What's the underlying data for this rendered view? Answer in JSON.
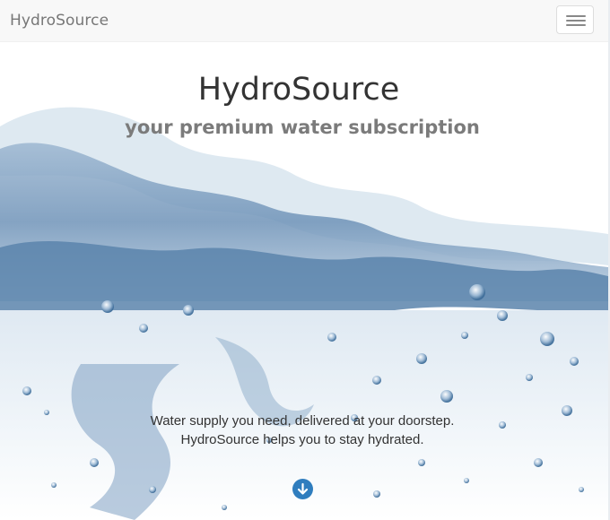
{
  "navbar": {
    "brand": "HydroSource",
    "menu_icon": "hamburger-menu-icon"
  },
  "hero": {
    "title": "HydroSource",
    "subtitle": "your premium water subscription",
    "text_line1": "Water supply you need, delivered at your doorstep.",
    "text_line2": "HydroSource helps you to stay hydrated.",
    "scroll_icon": "arrow-down-circle-icon"
  },
  "colors": {
    "accent": "#2f7dbe",
    "water_dark": "#5d86ad",
    "water_light": "#c9d9e8"
  }
}
